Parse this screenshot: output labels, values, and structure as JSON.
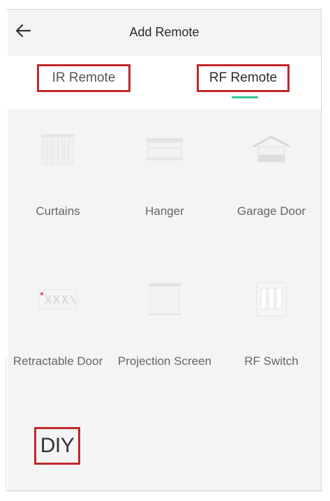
{
  "header": {
    "title": "Add Remote",
    "back_icon": "arrow-left-icon"
  },
  "tabs": [
    {
      "label": "IR Remote",
      "active": false
    },
    {
      "label": "RF Remote",
      "active": true
    }
  ],
  "colors": {
    "highlight_border": "#c1272d",
    "active_tab_indicator": "#2fc59a",
    "background": "#f4f4f4"
  },
  "devices": [
    {
      "label": "Curtains",
      "icon": "curtains-icon"
    },
    {
      "label": "Hanger",
      "icon": "hanger-icon"
    },
    {
      "label": "Garage Door",
      "icon": "garage-door-icon"
    },
    {
      "label": "Retractable Door",
      "icon": "retractable-door-icon"
    },
    {
      "label": "Projection Screen",
      "icon": "projection-screen-icon"
    },
    {
      "label": "RF Switch",
      "icon": "rf-switch-icon"
    }
  ],
  "diy": {
    "label": "DIY"
  }
}
